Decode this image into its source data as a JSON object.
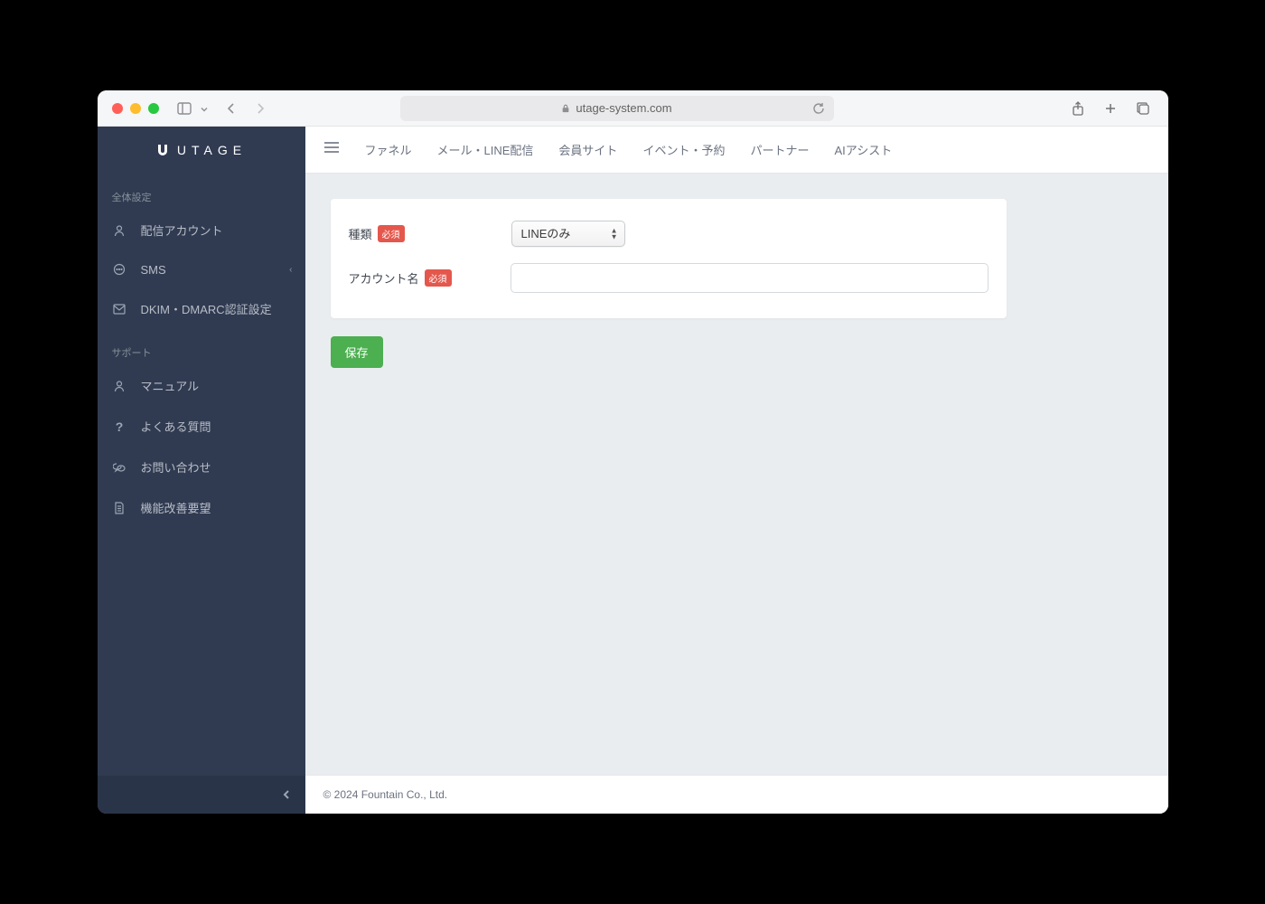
{
  "browser": {
    "url": "utage-system.com"
  },
  "sidebar": {
    "logo_text": "UTAGE",
    "section_global": "全体設定",
    "section_support": "サポート",
    "items": {
      "delivery_account": "配信アカウント",
      "sms": "SMS",
      "dkim": "DKIM・DMARC認証設定",
      "manual": "マニュアル",
      "faq": "よくある質問",
      "contact": "お問い合わせ",
      "feature_request": "機能改善要望"
    }
  },
  "topnav": {
    "funnel": "ファネル",
    "mail_line": "メール・LINE配信",
    "member_site": "会員サイト",
    "event": "イベント・予約",
    "partner": "パートナー",
    "ai_assist": "AIアシスト"
  },
  "form": {
    "type_label": "種類",
    "account_name_label": "アカウント名",
    "required_badge": "必須",
    "type_selected": "LINEのみ",
    "account_name_value": "",
    "save_label": "保存"
  },
  "footer": {
    "copyright": "© 2024 Fountain Co., Ltd."
  }
}
